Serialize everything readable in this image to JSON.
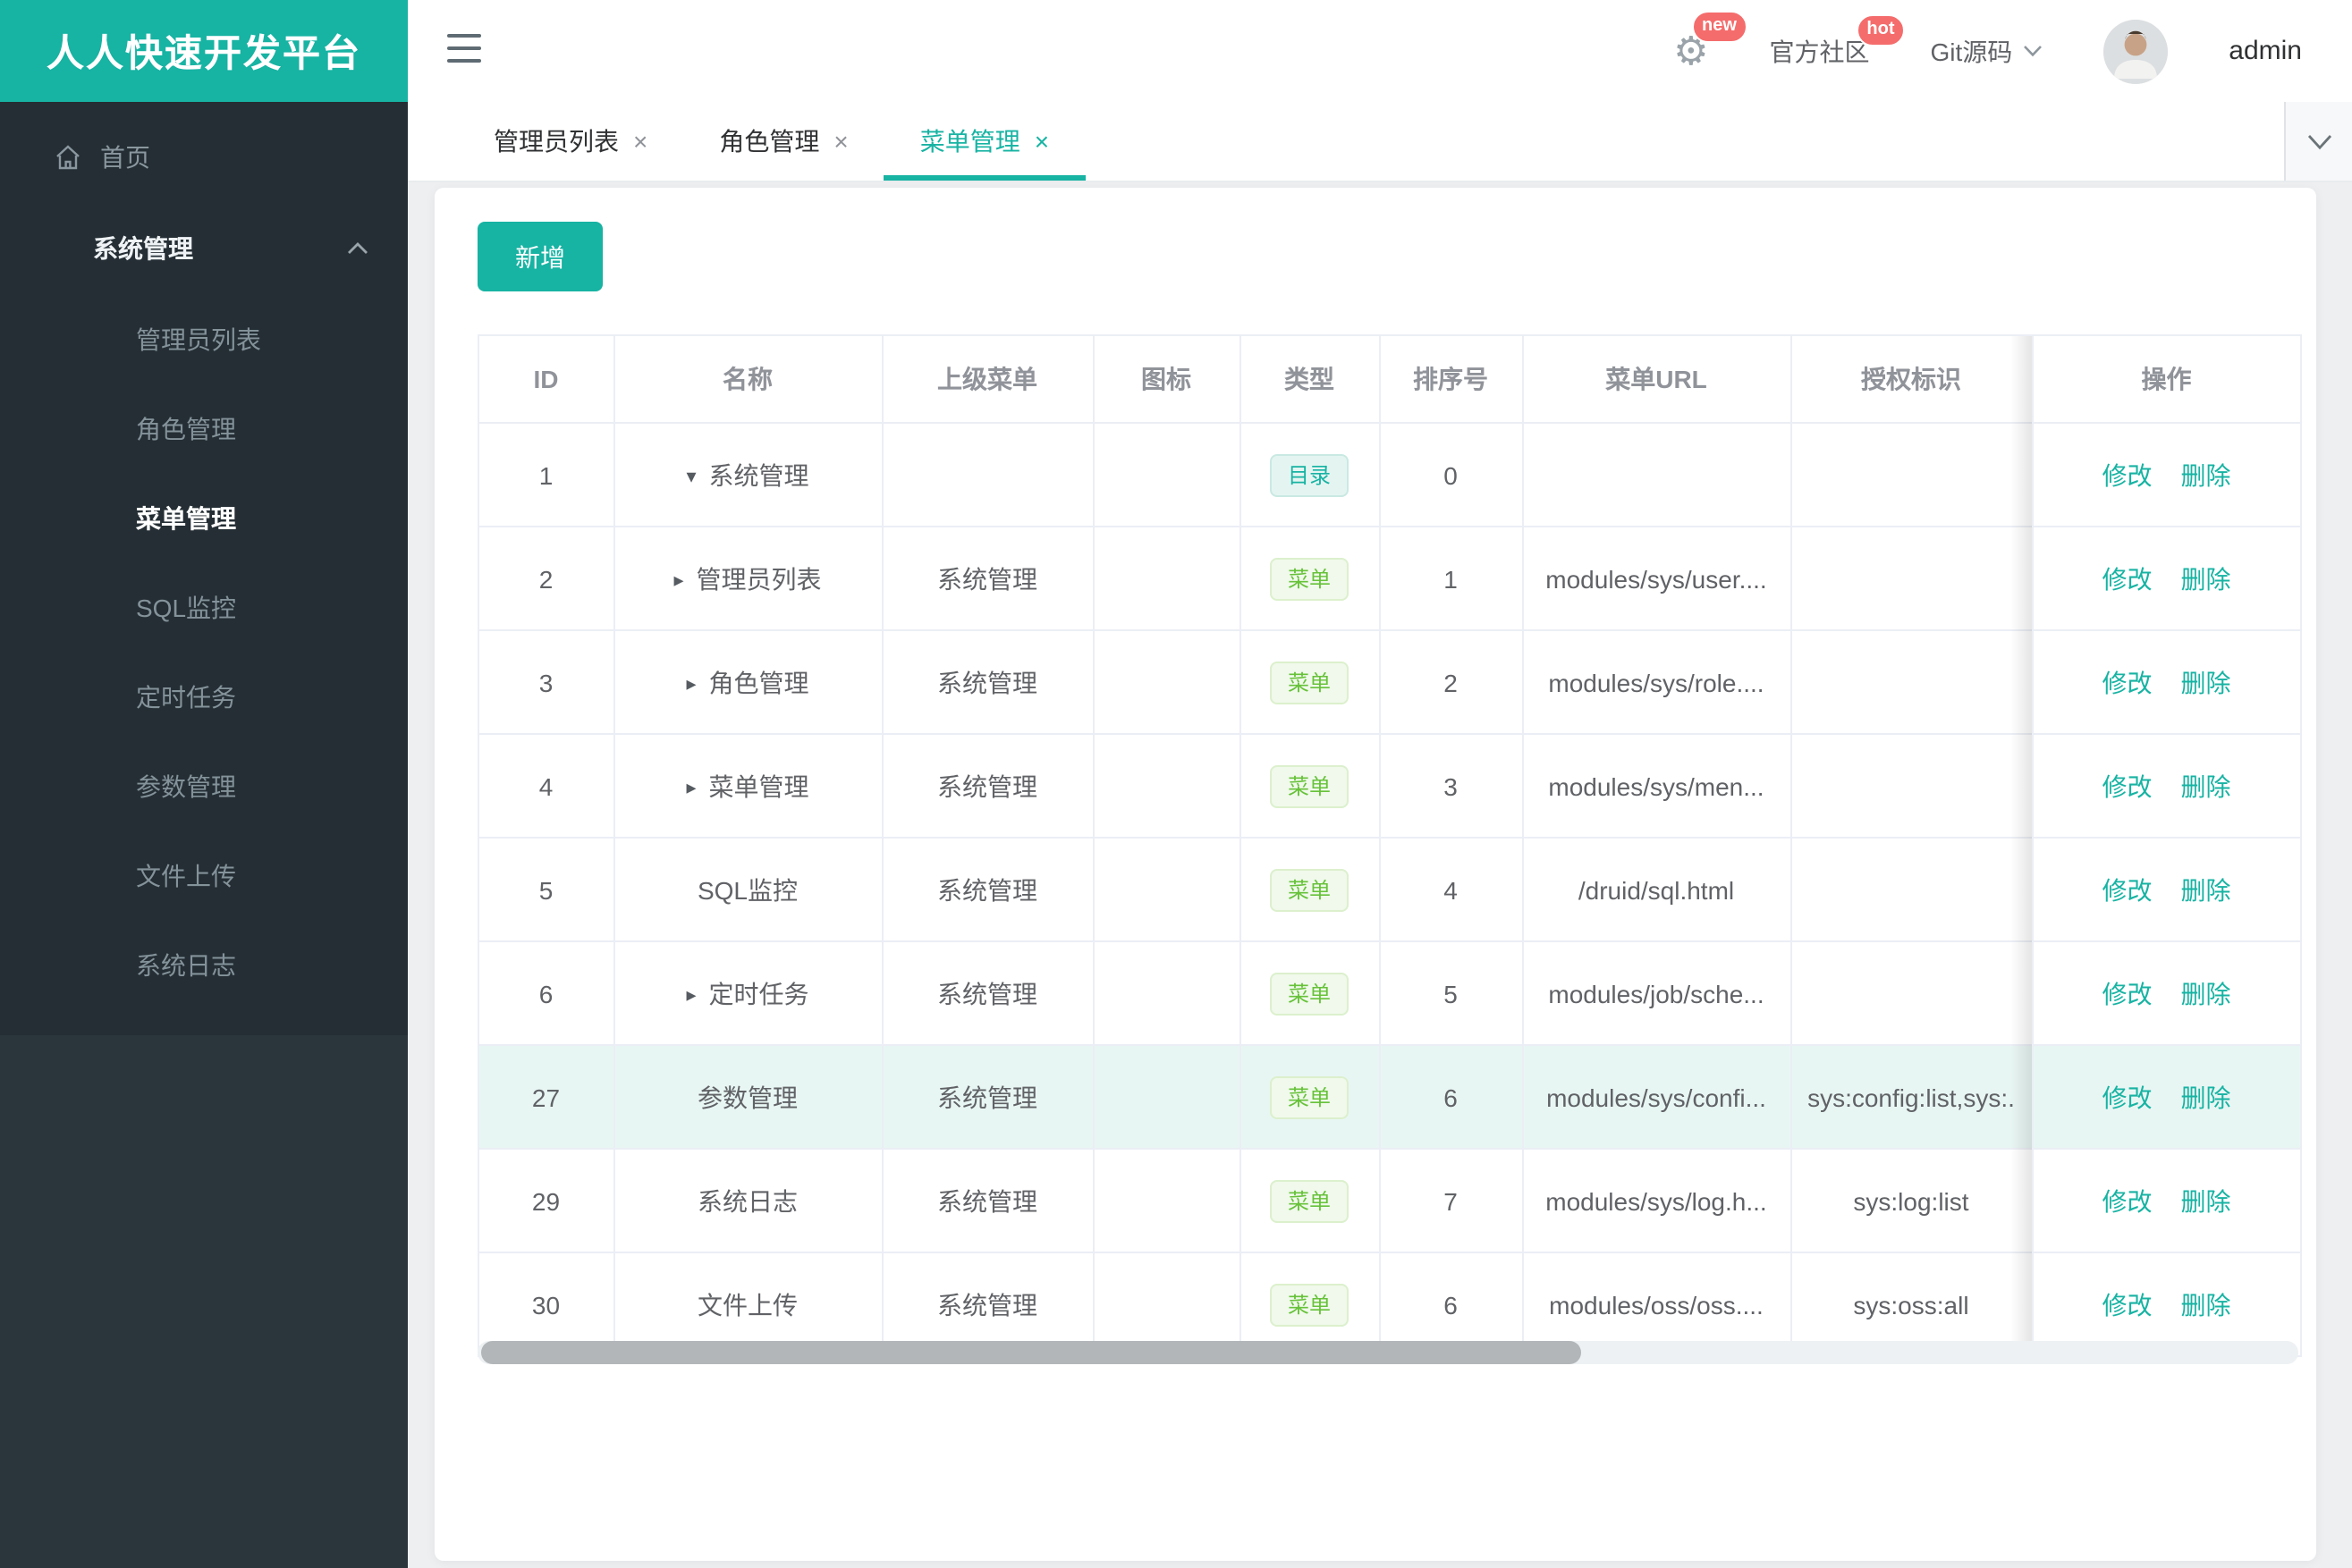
{
  "app": {
    "logo_title": "人人快速开发平台"
  },
  "topbar": {
    "username": "admin",
    "community_label": "官方社区",
    "git_label": "Git源码",
    "new_badge": "new",
    "hot_badge": "hot"
  },
  "sidebar": {
    "home_label": "首页",
    "section_label": "系统管理",
    "active_item": "菜单管理",
    "items": [
      "管理员列表",
      "角色管理",
      "菜单管理",
      "SQL监控",
      "定时任务",
      "参数管理",
      "文件上传",
      "系统日志"
    ]
  },
  "tabs": {
    "close_glyph": "×",
    "items": [
      {
        "label": "管理员列表",
        "active": false
      },
      {
        "label": "角色管理",
        "active": false
      },
      {
        "label": "菜单管理",
        "active": true
      }
    ]
  },
  "toolbar": {
    "add_label": "新增"
  },
  "table": {
    "columns": [
      "ID",
      "名称",
      "上级菜单",
      "图标",
      "类型",
      "排序号",
      "菜单URL",
      "授权标识",
      "操作"
    ],
    "badge_labels": {
      "dir": "目录",
      "menu": "菜单"
    },
    "action_labels": {
      "edit": "修改",
      "delete": "删除"
    },
    "rows": [
      {
        "id": "1",
        "expander": "down",
        "name": "系统管理",
        "parent": "",
        "icon": "",
        "type": "dir",
        "order": "0",
        "url": "",
        "perms": "",
        "highlight": false
      },
      {
        "id": "2",
        "expander": "right",
        "name": "管理员列表",
        "parent": "系统管理",
        "icon": "",
        "type": "menu",
        "order": "1",
        "url": "modules/sys/user....",
        "perms": "",
        "highlight": false
      },
      {
        "id": "3",
        "expander": "right",
        "name": "角色管理",
        "parent": "系统管理",
        "icon": "",
        "type": "menu",
        "order": "2",
        "url": "modules/sys/role....",
        "perms": "",
        "highlight": false
      },
      {
        "id": "4",
        "expander": "right",
        "name": "菜单管理",
        "parent": "系统管理",
        "icon": "",
        "type": "menu",
        "order": "3",
        "url": "modules/sys/men...",
        "perms": "",
        "highlight": false
      },
      {
        "id": "5",
        "expander": "",
        "name": "SQL监控",
        "parent": "系统管理",
        "icon": "",
        "type": "menu",
        "order": "4",
        "url": "/druid/sql.html",
        "perms": "",
        "highlight": false
      },
      {
        "id": "6",
        "expander": "right",
        "name": "定时任务",
        "parent": "系统管理",
        "icon": "",
        "type": "menu",
        "order": "5",
        "url": "modules/job/sche...",
        "perms": "",
        "highlight": false
      },
      {
        "id": "27",
        "expander": "",
        "name": "参数管理",
        "parent": "系统管理",
        "icon": "",
        "type": "menu",
        "order": "6",
        "url": "modules/sys/confi...",
        "perms": "sys:config:list,sys:.",
        "highlight": true
      },
      {
        "id": "29",
        "expander": "",
        "name": "系统日志",
        "parent": "系统管理",
        "icon": "",
        "type": "menu",
        "order": "7",
        "url": "modules/sys/log.h...",
        "perms": "sys:log:list",
        "highlight": false
      },
      {
        "id": "30",
        "expander": "",
        "name": "文件上传",
        "parent": "系统管理",
        "icon": "",
        "type": "menu",
        "order": "6",
        "url": "modules/oss/oss....",
        "perms": "sys:oss:all",
        "highlight": false
      }
    ]
  },
  "colors": {
    "primary": "#17b3a3",
    "badge_red": "#f56c6c",
    "menu_green": "#67c23a",
    "row_highlight": "#e8f6f3"
  }
}
